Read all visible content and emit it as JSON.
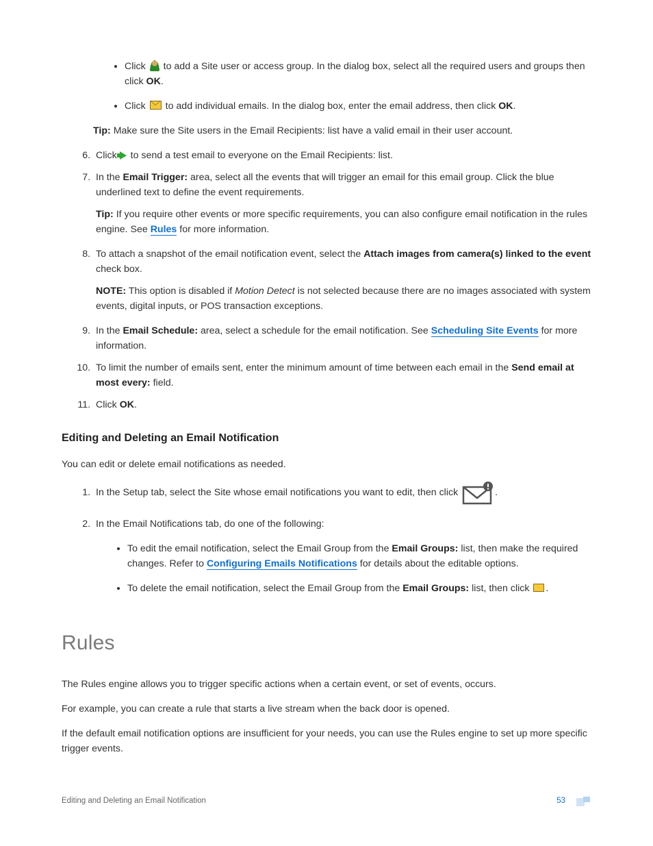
{
  "bullets_top": {
    "item1": {
      "pre": "Click ",
      "post": " to add a Site user or access group. In the dialog box, select all the required users and groups then click ",
      "ok": "OK",
      "end": "."
    },
    "item2": {
      "pre": "Click ",
      "post": " to add individual emails. In the dialog box, enter the email address, then click ",
      "ok": "OK",
      "end": "."
    }
  },
  "tip1": {
    "label": "Tip:",
    "text": " Make sure the Site users in the Email Recipients: list have a valid email in their user account."
  },
  "steps": {
    "s6": {
      "pre": "Click ",
      "post": " to send a test email to everyone on the Email Recipients: list."
    },
    "s7": {
      "pre": "In the ",
      "bold": "Email Trigger:",
      "post": " area, select all the events that will trigger an email for this email group. Click the blue underlined text to define the event requirements.",
      "tip_label": "Tip:",
      "tip_pre": " If you require other events or more specific requirements, you can also configure email notification in the rules engine. See ",
      "tip_link": "Rules",
      "tip_post": " for more information."
    },
    "s8": {
      "pre": "To attach a snapshot of the email notification event, select the ",
      "bold": "Attach images from camera(s) linked to the event",
      "post": " check box.",
      "note_label": "NOTE:",
      "note_pre": " This option is disabled if ",
      "note_em": "Motion Detect",
      "note_post": " is not selected because there are no images associated with system events, digital inputs, or POS transaction exceptions."
    },
    "s9": {
      "pre": "In the ",
      "bold": "Email Schedule:",
      "mid": " area, select a schedule for the email notification. See ",
      "link": "Scheduling Site Events",
      "post": " for more information."
    },
    "s10": {
      "pre": "To limit the number of emails sent, enter the minimum amount of time between each email in the ",
      "bold": "Send email at most every:",
      "post": " field."
    },
    "s11": {
      "pre": "Click ",
      "bold": "OK",
      "post": "."
    }
  },
  "sectionA": {
    "title": "Editing and Deleting an Email Notification",
    "intro": "You can edit or delete email notifications as needed.",
    "ol": {
      "i1": {
        "pre": "In the Setup tab, select the Site whose email notifications you want to edit, then click ",
        "post": "."
      },
      "i2": {
        "text": "In the Email Notifications tab, do one of the following:"
      }
    },
    "sub": {
      "b1": {
        "pre": "To edit the email notification, select the Email Group from the ",
        "bold": "Email Groups:",
        "mid": " list, then make the required changes. Refer to ",
        "link": "Configuring Emails Notifications",
        "post": " for details about the editable options."
      },
      "b2": {
        "pre": "To delete the email notification, select the Email Group from the ",
        "bold": "Email Groups:",
        "mid": " list, then click ",
        "post": "."
      }
    }
  },
  "rules": {
    "title": "Rules",
    "p1": "The Rules engine allows you to trigger specific actions when a certain event, or set of events, occurs.",
    "p2": "For example, you can create a rule that starts a live stream when the back door is opened.",
    "p3": "If the default email notification options are insufficient for your needs, you can use the Rules engine to set up more specific trigger events."
  },
  "footer": {
    "left": "Editing and Deleting an Email Notification",
    "page": "53"
  }
}
